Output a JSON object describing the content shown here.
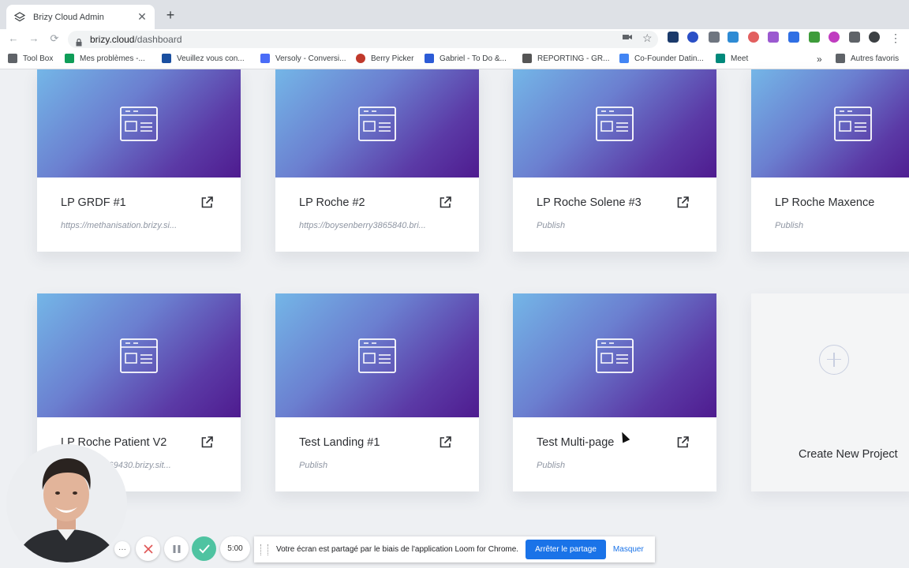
{
  "browser": {
    "tab_title": "Brizy Cloud Admin",
    "tab_close": "✕",
    "new_tab": "+",
    "url_host": "brizy.cloud",
    "url_path": "/dashboard",
    "back": "←",
    "forward": "→",
    "reload": "⟳",
    "menu": "⋮"
  },
  "bookmarks": [
    {
      "label": "Tool Box",
      "icon": "folder-icon",
      "color": "#5f6368"
    },
    {
      "label": "Mes problèmes -...",
      "icon": "sheets-icon",
      "color": "#0f9d58"
    },
    {
      "label": "Veuillez vous con...",
      "icon": "radio-icon",
      "color": "#1a4fa0"
    },
    {
      "label": "Versoly - Conversi...",
      "icon": "versoly-icon",
      "color": "#4a6cf7"
    },
    {
      "label": "Berry Picker",
      "icon": "berry-icon",
      "color": "#c0392b"
    },
    {
      "label": "Gabriel - To Do &...",
      "icon": "stack-icon",
      "color": "#2c5bd6"
    },
    {
      "label": "REPORTING - GR...",
      "icon": "chart-icon",
      "color": "#555"
    },
    {
      "label": "Co-Founder Datin...",
      "icon": "docs-icon",
      "color": "#4285f4"
    },
    {
      "label": "Meet",
      "icon": "meet-icon",
      "color": "#00897b"
    }
  ],
  "bookmarks_more": "»",
  "bookmarks_other": "Autres favoris",
  "projects": [
    {
      "title": "LP GRDF #1",
      "link": "https://methanisation.brizy.si..."
    },
    {
      "title": "LP Roche #2",
      "link": "https://boysenberry3865840.bri..."
    },
    {
      "title": "LP Roche Solene #3",
      "link": "Publish"
    },
    {
      "title": "LP Roche Maxence",
      "link": "Publish"
    },
    {
      "title": "LP Roche Patient V2",
      "link": "https://...n4069430.brizy.sit..."
    },
    {
      "title": "Test Landing #1",
      "link": "Publish"
    },
    {
      "title": "Test Multi-page",
      "link": "Publish"
    }
  ],
  "create_project": "Create New Project",
  "loom": {
    "more": "···",
    "timer": "5:00",
    "share_message": "Votre écran est partagé par le biais de l'application Loom for Chrome.",
    "stop_sharing": "Arrêter le partage",
    "hide": "Masquer"
  },
  "colors": {
    "gradient_start": "#74b6e7",
    "gradient_end": "#4e1b8f",
    "loom_check": "#4fc3a1",
    "loom_cancel": "#e05555",
    "chrome_blue": "#1a73e8"
  }
}
